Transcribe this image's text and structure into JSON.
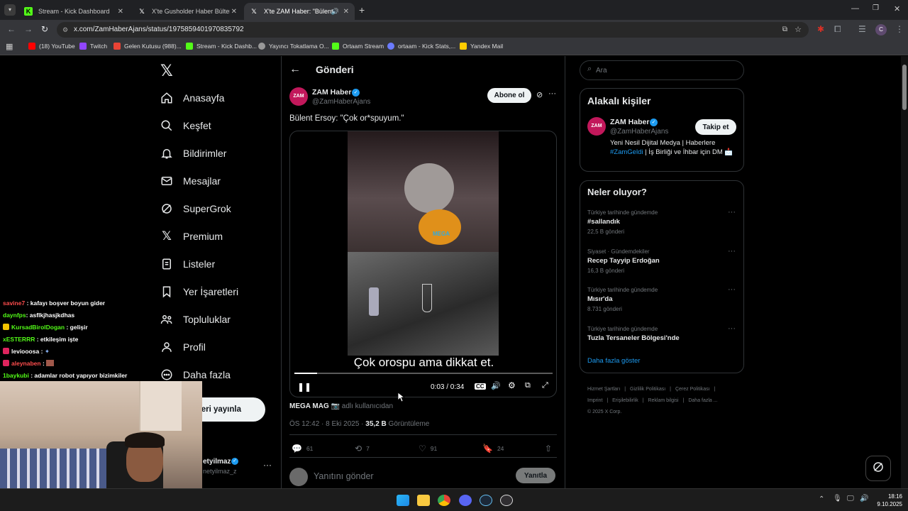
{
  "browser": {
    "tabs": [
      {
        "label": "Stream - Kick Dashboard",
        "icon": "kick-icon"
      },
      {
        "label": "X'te Gusholder Haber Bülteni: \"",
        "icon": "x-logo-icon"
      },
      {
        "label": "X'te ZAM Haber: \"Bülent Er",
        "icon": "x-logo-icon"
      }
    ],
    "url": "x.com/ZamHaberAjans/status/1975859401970835792",
    "bookmarks": [
      "(18) YouTube",
      "Twitch",
      "Gelen Kutusu (988)...",
      "Stream - Kick Dashb...",
      "Yayıncı Tokatlama O...",
      "Ortaam Stream",
      "ortaam - Kick Stats,...",
      "Yandex Mail"
    ],
    "colors": {
      "kick": "#53fc18",
      "twitch": "#9146ff",
      "youtube": "#ff0000"
    }
  },
  "nav": {
    "items": [
      {
        "label": "Anasayfa",
        "icon": "home-icon"
      },
      {
        "label": "Keşfet",
        "icon": "search-icon"
      },
      {
        "label": "Bildirimler",
        "icon": "bell-icon"
      },
      {
        "label": "Mesajlar",
        "icon": "mail-icon"
      },
      {
        "label": "SuperGrok",
        "icon": "grok-icon"
      },
      {
        "label": "Premium",
        "icon": "x-logo-icon"
      },
      {
        "label": "Listeler",
        "icon": "list-icon"
      },
      {
        "label": "Yer İşaretleri",
        "icon": "bookmark-icon"
      },
      {
        "label": "Topluluklar",
        "icon": "community-icon"
      },
      {
        "label": "Profil",
        "icon": "person-icon"
      },
      {
        "label": "Daha fazla",
        "icon": "more-circle-icon"
      }
    ],
    "post_button_fragment": "eri yayınla",
    "account_name_fragment": "etyilmaz",
    "account_handle_fragment": "netyilmaz_z"
  },
  "post": {
    "header_title": "Gönderi",
    "author_name": "ZAM Haber",
    "author_handle": "@ZamHaberAjans",
    "avatar_text": "ZAM",
    "subscribe_label": "Abone ol",
    "text": "Bülent Ersoy: \"Çok or*spuyum.\"",
    "video": {
      "subtitle": "Çok orospu ama dikkat et.",
      "time": "0:03 / 0:34",
      "progress": 0.088,
      "watermark": "MEGA"
    },
    "source_name": "MEGA MAG",
    "source_suffix": "adlı kullanıcıdan",
    "timestamp": "ÖS 12:42 · 8 Eki 2025 ·",
    "views_count": "35,2 B",
    "views_label": "Görüntüleme",
    "counts": {
      "replies": "61",
      "reposts": "7",
      "likes": "91",
      "bookmarks": "24"
    },
    "reply_placeholder": "Yanıtını gönder",
    "reply_button": "Yanıtla"
  },
  "sidebar": {
    "search_placeholder": "Ara",
    "related_title": "Alakalı kişiler",
    "related": {
      "name": "ZAM Haber",
      "handle": "@ZamHaberAjans",
      "follow_label": "Takip et",
      "bio_part1": "Yeni Nesil Dijital Medya | Haberlere",
      "bio_hashtag": "#ZamGeldi",
      "bio_part2": "| İş Birliği ve İhbar için DM"
    },
    "trends_title": "Neler oluyor?",
    "trends": [
      {
        "context": "Türkiye tarihinde gündemde",
        "title": "#sallandık",
        "count": "22,5 B gönderi"
      },
      {
        "context": "Siyaset · Gündemdekiler",
        "title": "Recep Tayyip Erdoğan",
        "count": "16,3 B gönderi"
      },
      {
        "context": "Türkiye tarihinde gündemde",
        "title": "Mısır'da",
        "count": "8.731 gönderi"
      },
      {
        "context": "Türkiye tarihinde gündemde",
        "title": "Tuzla Tersaneler Bölgesi'nde",
        "count": ""
      }
    ],
    "show_more": "Daha fazla göster",
    "footer": {
      "links1": [
        "Hizmet Şartları",
        "Gizlilik Politikası",
        "Çerez Politikası"
      ],
      "links2": [
        "Imprint",
        "Erişilebilirlik",
        "Reklam bilgisi",
        "Daha fazla ..."
      ],
      "copyright": "© 2025 X Corp."
    }
  },
  "chat": [
    {
      "user": "savine7",
      "msg": ": kafayı boşver boyun gider",
      "color": "#ff4d4d"
    },
    {
      "user": "daynfps",
      "msg": ": asflkjhasjkdhas",
      "color": "#53fc18"
    },
    {
      "user": "KursadBirolDogan",
      "msg": ": gelişir",
      "color": "#53fc18"
    },
    {
      "user": "xESTERRR",
      "msg": ": etkileşim işte",
      "color": "#53fc18"
    },
    {
      "user": "leviooosa",
      "msg": ":",
      "color": "#ffffff"
    },
    {
      "user": "aleynaben",
      "msg": ":",
      "color": "#ff4d4d"
    },
    {
      "user": "1baykubi",
      "msg": ": adamlar robot yapıyor bizimkiler",
      "color": "#53fc18"
    }
  ],
  "taskbar": {
    "time": "18:16",
    "date": "9.10.2025"
  }
}
